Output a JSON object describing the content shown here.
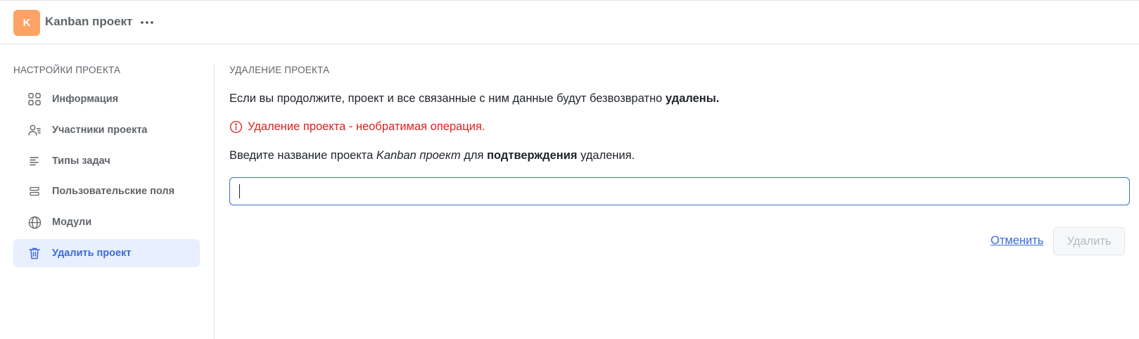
{
  "header": {
    "avatar_letter": "K",
    "avatar_color": "#ffa266",
    "project_title": "Kanban проект",
    "more_icon": "ellipsis-icon"
  },
  "sidebar": {
    "heading": "НАСТРОЙКИ ПРОЕКТА",
    "items": [
      {
        "label": "Информация",
        "icon": "grid-icon",
        "active": false
      },
      {
        "label": "Участники проекта",
        "icon": "members-icon",
        "active": false
      },
      {
        "label": "Типы задач",
        "icon": "lines-icon",
        "active": false
      },
      {
        "label": "Пользовательские поля",
        "icon": "fields-icon",
        "active": false
      },
      {
        "label": "Модули",
        "icon": "globe-icon",
        "active": false
      },
      {
        "label": "Удалить проект",
        "icon": "trash-icon",
        "active": true
      }
    ]
  },
  "main": {
    "heading": "УДАЛЕНИЕ ПРОЕКТА",
    "paragraph1_text": "Если вы продолжите, проект и все связанные с ним данные будут безвозвратно ",
    "paragraph1_bold": "удалены.",
    "warning_text": "Удаление проекта - необратимая операция.",
    "paragraph2_before": "Введите название проекта ",
    "paragraph2_italic": "Kanban проект",
    "paragraph2_middle": " для ",
    "paragraph2_bold": "подтверждения",
    "paragraph2_after": " удаления.",
    "input_value": "",
    "input_placeholder": "",
    "cancel_label": "Отменить",
    "delete_label": "Удалить"
  },
  "colors": {
    "accent": "#3b6bd6",
    "active_bg": "#e8efff",
    "warning": "#e02020",
    "muted_text": "#5f6469"
  }
}
